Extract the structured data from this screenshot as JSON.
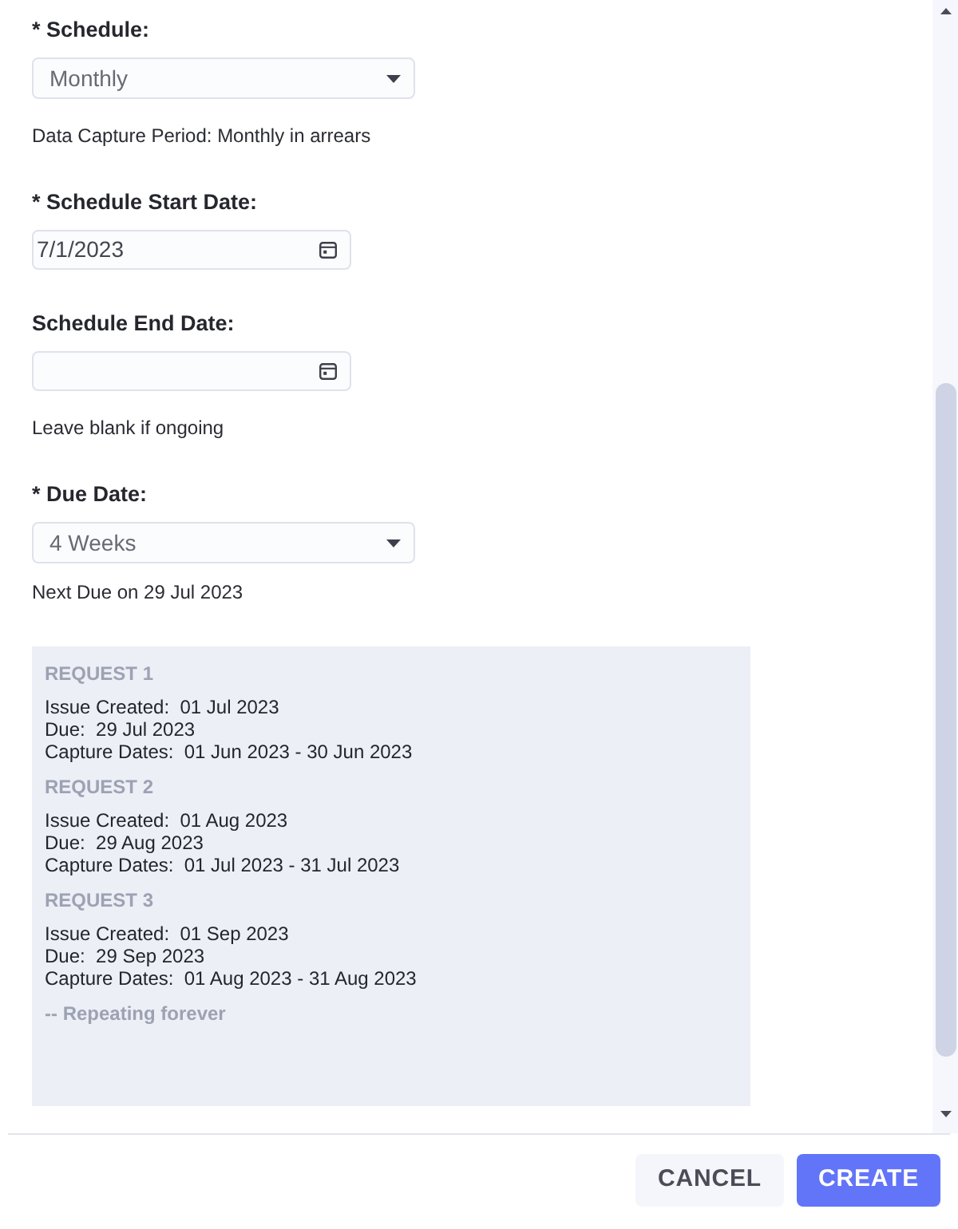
{
  "fields": [
    {
      "kind": "select",
      "label": "* Schedule:",
      "value": "Monthly",
      "help": "Data Capture Period: Monthly in arrears"
    },
    {
      "kind": "date",
      "label": "* Schedule Start Date:",
      "value": "7/1/2023"
    },
    {
      "kind": "date",
      "label": "Schedule End Date:",
      "help": "Leave blank if ongoing"
    },
    {
      "kind": "select",
      "label": "* Due Date:",
      "value": "4 Weeks",
      "help": "Next Due on 29 Jul 2023"
    }
  ],
  "requests": [
    {
      "title": "REQUEST 1",
      "lines": [
        "Issue Created:  01 Jul 2023",
        "Due:  29 Jul 2023",
        "Capture Dates:  01 Jun 2023 - 30 Jun 2023"
      ]
    },
    {
      "title": "REQUEST 2",
      "lines": [
        "Issue Created:  01 Aug 2023",
        "Due:  29 Aug 2023",
        "Capture Dates:  01 Jul 2023 - 31 Jul 2023"
      ]
    },
    {
      "title": "REQUEST 3",
      "lines": [
        "Issue Created:  01 Sep 2023",
        "Due:  29 Sep 2023",
        "Capture Dates:  01 Aug 2023 - 31 Aug 2023"
      ]
    }
  ],
  "footnote": "-- Repeating forever",
  "buttons": [
    {
      "label": "CANCEL",
      "kind": "secondary"
    },
    {
      "label": "CREATE",
      "kind": "primary"
    }
  ]
}
